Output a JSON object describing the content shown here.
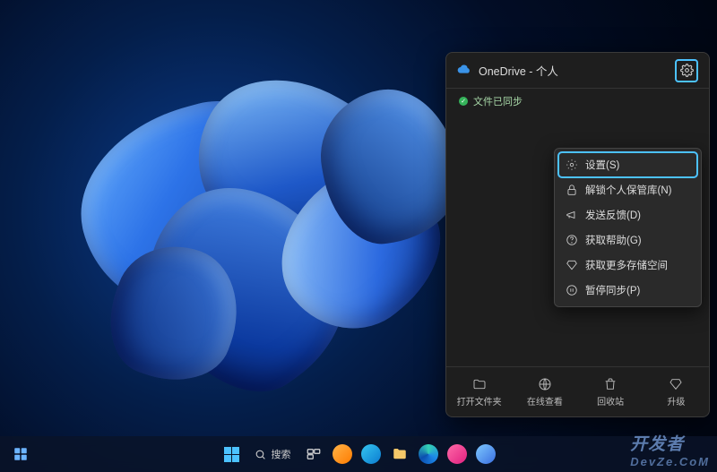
{
  "taskbar": {
    "search_placeholder": "搜索"
  },
  "flyout": {
    "title": "OneDrive - 个人",
    "status": "文件已同步",
    "menu": [
      {
        "label": "设置(S)"
      },
      {
        "label": "解锁个人保管库(N)"
      },
      {
        "label": "发送反馈(D)"
      },
      {
        "label": "获取帮助(G)"
      },
      {
        "label": "获取更多存储空间"
      },
      {
        "label": "暂停同步(P)"
      }
    ],
    "bottom": [
      {
        "label": "打开文件夹"
      },
      {
        "label": "在线查看"
      },
      {
        "label": "回收站"
      },
      {
        "label": "升级"
      }
    ]
  },
  "watermark": {
    "line1": "开发者",
    "line2": "DevZe.CoM"
  }
}
